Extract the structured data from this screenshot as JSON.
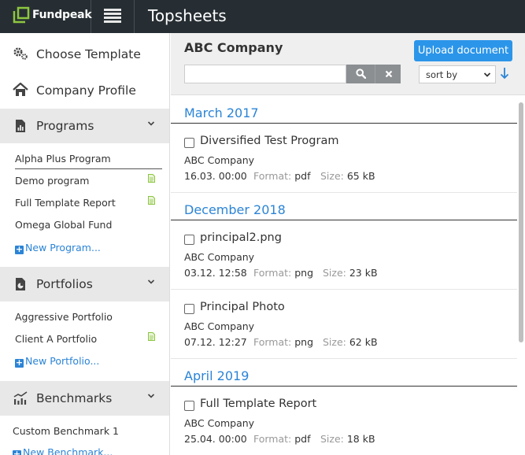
{
  "header": {
    "logo_text": "Fundpeak",
    "app_title": "Topsheets",
    "colors": {
      "bar": "#262e33",
      "logo_green": "#8dc63f",
      "accent": "#2b84d6"
    }
  },
  "sidebar": {
    "choose_template": "Choose Template",
    "company_profile": "Company Profile",
    "programs": {
      "title": "Programs",
      "items": [
        {
          "label": "Alpha Plus Program",
          "active": true,
          "has_doc": false
        },
        {
          "label": "Demo program",
          "has_doc": true
        },
        {
          "label": "Full Template Report",
          "has_doc": true
        },
        {
          "label": "Omega Global Fund",
          "has_doc": false
        }
      ],
      "new_label": "New Program..."
    },
    "portfolios": {
      "title": "Portfolios",
      "items": [
        {
          "label": "Aggressive Portfolio",
          "has_doc": false
        },
        {
          "label": "Client A Portfolio",
          "has_doc": true
        }
      ],
      "new_label": "New Portfolio..."
    },
    "benchmarks": {
      "title": "Benchmarks",
      "items": [
        {
          "label": "Custom Benchmark 1"
        }
      ],
      "new_label": "New Benchmark..."
    }
  },
  "main": {
    "company_title": "ABC Company",
    "upload_label": "Upload document",
    "search": {
      "value": "",
      "placeholder": ""
    },
    "sort": {
      "selected": "sort by"
    },
    "groups": [
      {
        "month": "March 2017",
        "docs": [
          {
            "name": "Diversified Test Program",
            "company": "ABC Company",
            "date": "16.03. 00:00",
            "format_label": "Format:",
            "format": "pdf",
            "size_label": "Size:",
            "size": "65 kB"
          }
        ]
      },
      {
        "month": "December 2018",
        "docs": [
          {
            "name": "principal2.png",
            "company": "ABC Company",
            "date": "03.12. 12:58",
            "format_label": "Format:",
            "format": "png",
            "size_label": "Size:",
            "size": "23 kB"
          },
          {
            "name": "Principal Photo",
            "company": "ABC Company",
            "date": "07.12. 12:27",
            "format_label": "Format:",
            "format": "png",
            "size_label": "Size:",
            "size": "62 kB"
          }
        ]
      },
      {
        "month": "April 2019",
        "docs": [
          {
            "name": "Full Template Report",
            "company": "ABC Company",
            "date": "25.04. 00:00",
            "format_label": "Format:",
            "format": "pdf",
            "size_label": "Size:",
            "size": "18 kB"
          }
        ]
      }
    ]
  }
}
